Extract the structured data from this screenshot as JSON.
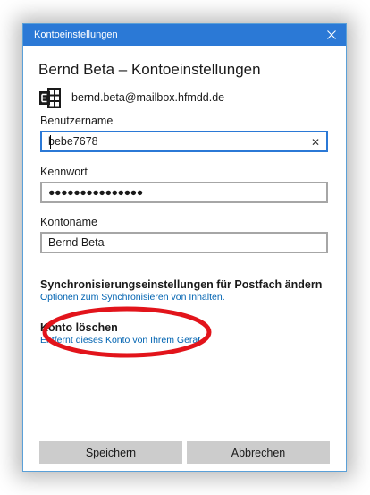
{
  "window": {
    "title": "Kontoeinstellungen",
    "close_icon": "close-icon"
  },
  "heading": "Bernd Beta – Kontoeinstellungen",
  "account": {
    "email": "bernd.beta@mailbox.hfmdd.de",
    "logo_icon": "exchange-logo-icon"
  },
  "fields": {
    "username": {
      "label": "Benutzername",
      "value": "bebe7678"
    },
    "password": {
      "label": "Kennwort",
      "value": "●●●●●●●●●●●●●●●"
    },
    "account_name": {
      "label": "Kontoname",
      "value": "Bernd Beta"
    }
  },
  "sync": {
    "title": "Synchronisierungseinstellungen für Postfach ändern",
    "link": "Optionen zum Synchronisieren von Inhalten."
  },
  "delete": {
    "title": "Konto löschen",
    "link": "Entfernt dieses Konto von Ihrem Gerät."
  },
  "buttons": {
    "save": "Speichern",
    "cancel": "Abbrechen"
  },
  "colors": {
    "accent": "#2b79d6",
    "link": "#0063b1",
    "highlight_ellipse": "#e2141b"
  }
}
